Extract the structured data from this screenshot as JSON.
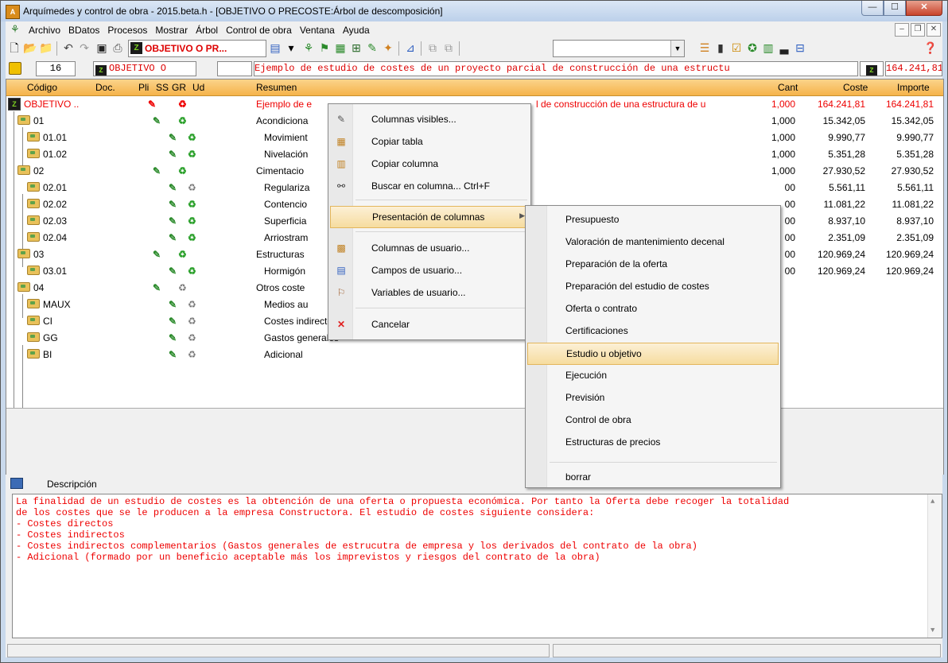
{
  "window": {
    "title": "Arquímedes y control de obra - 2015.beta.h - [OBJETIVO O PRECOSTE:Árbol de descomposición]"
  },
  "menu": {
    "items": [
      "Archivo",
      "BDatos",
      "Procesos",
      "Mostrar",
      "Árbol",
      "Control de obra",
      "Ventana",
      "Ayuda"
    ]
  },
  "toolbar": {
    "dropdown_value": "OBJETIVO O PR...",
    "combo_value": ""
  },
  "infobar": {
    "number": "16",
    "code": "OBJETIVO O",
    "empty": "",
    "summary": "Ejemplo de estudio de costes de un proyecto parcial de construcción de una estructu",
    "total": "164.241,81"
  },
  "table": {
    "headers": {
      "codigo": "Código",
      "doc": "Doc.",
      "pli": "Pli",
      "ss": "SS",
      "gr": "GR",
      "ud": "Ud",
      "resumen": "Resumen",
      "cant": "Cant",
      "coste": "Coste",
      "importe": "Importe"
    },
    "root": {
      "codigo": "OBJETIVO ..",
      "resumen": "Ejemplo de e",
      "resumen_tail": "l de construcción de una estructura de u",
      "cant": "1,000",
      "coste": "164.241,81",
      "importe": "164.241,81"
    },
    "rows": [
      {
        "codigo": "01",
        "resumen": "Acondiciona",
        "cant": "1,000",
        "coste": "15.342,05",
        "importe": "15.342,05"
      },
      {
        "codigo": "01.01",
        "resumen": "Movimient",
        "cant": "1,000",
        "coste": "9.990,77",
        "importe": "9.990,77"
      },
      {
        "codigo": "01.02",
        "resumen": "Nivelación",
        "cant": "1,000",
        "coste": "5.351,28",
        "importe": "5.351,28"
      },
      {
        "codigo": "02",
        "resumen": "Cimentacio",
        "cant": "1,000",
        "coste": "27.930,52",
        "importe": "27.930,52"
      },
      {
        "codigo": "02.01",
        "resumen": "Regulariza",
        "cant": "00",
        "coste": "5.561,11",
        "importe": "5.561,11"
      },
      {
        "codigo": "02.02",
        "resumen": "Contencio",
        "cant": "00",
        "coste": "11.081,22",
        "importe": "11.081,22"
      },
      {
        "codigo": "02.03",
        "resumen": "Superficia",
        "cant": "00",
        "coste": "8.937,10",
        "importe": "8.937,10"
      },
      {
        "codigo": "02.04",
        "resumen": "Arriostram",
        "cant": "00",
        "coste": "2.351,09",
        "importe": "2.351,09"
      },
      {
        "codigo": "03",
        "resumen": "Estructuras",
        "cant": "00",
        "coste": "120.969,24",
        "importe": "120.969,24"
      },
      {
        "codigo": "03.01",
        "resumen": "Hormigón",
        "cant": "00",
        "coste": "120.969,24",
        "importe": "120.969,24"
      },
      {
        "codigo": "04",
        "resumen": "Otros coste",
        "cant": "",
        "coste": "",
        "importe": ""
      },
      {
        "codigo": "MAUX",
        "resumen": "Medios au",
        "cant": "",
        "coste": "",
        "importe": ""
      },
      {
        "codigo": "CI",
        "resumen": "Costes indirectos",
        "cant": "",
        "coste": "",
        "importe": ""
      },
      {
        "codigo": "GG",
        "resumen": "Gastos generales",
        "cant": "",
        "coste": "",
        "importe": ""
      },
      {
        "codigo": "BI",
        "resumen": "Adicional",
        "cant": "",
        "coste": "",
        "importe": ""
      }
    ]
  },
  "context_menu": {
    "columnas_visibles": "Columnas visibles...",
    "copiar_tabla": "Copiar tabla",
    "copiar_columna": "Copiar columna",
    "buscar_en_columna": "Buscar en columna...",
    "buscar_shortcut": "Ctrl+F",
    "presentacion_columnas": "Presentación de columnas",
    "columnas_usuario": "Columnas de usuario...",
    "campos_usuario": "Campos de usuario...",
    "variables_usuario": "Variables de usuario...",
    "cancelar": "Cancelar"
  },
  "submenu": {
    "items": [
      "Presupuesto",
      "Valoración de mantenimiento decenal",
      "Preparación de la oferta",
      "Preparación del estudio de costes",
      "Oferta o contrato",
      "Certificaciones",
      "Estudio u objetivo",
      "Ejecución",
      "Previsión",
      "Control de obra",
      "Estructuras de precios"
    ],
    "selected": "Estudio u objetivo",
    "borrar": "borrar"
  },
  "description": {
    "header": "Descripción",
    "lines": [
      "La finalidad de un estudio de costes es la obtención de una oferta o propuesta económica. Por tanto la Oferta debe recoger la totalidad",
      "de los costes que se le producen a la empresa Constructora. El estudio de costes siguiente considera:",
      "- Costes directos",
      "- Costes indirectos",
      "- Costes indirectos complementarios (Gastos generales de estrucutra de empresa y los derivados del contrato de la obra)",
      "- Adicional (formado por un beneficio aceptable más los imprevistos y riesgos del contrato de la obra)"
    ]
  },
  "colors": {
    "accent": "#f5b34a",
    "red_text": "#e00000",
    "green_icon": "#2a8a2a"
  }
}
